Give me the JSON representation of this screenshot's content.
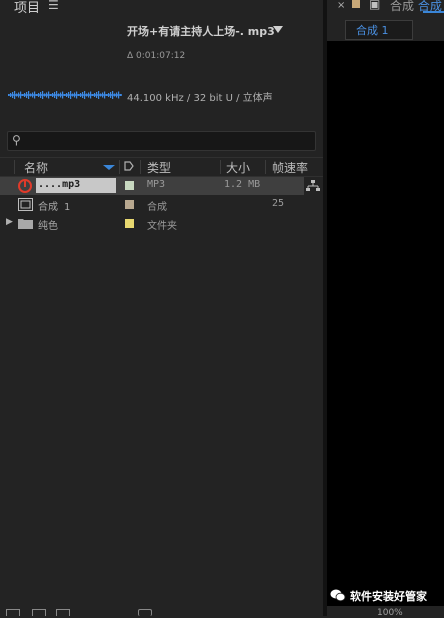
{
  "project_panel": {
    "title": "项目",
    "menu_icon": "hamburger-icon",
    "selected_file": {
      "name": "开场+有请主持人上场-. mp3",
      "duration": "Δ 0:01:07:12",
      "audio_info": "44.100 kHz / 32 bit U / 立体声"
    },
    "search": {
      "placeholder": "",
      "value": ""
    },
    "columns": [
      {
        "label": "名称"
      },
      {
        "label": "类型"
      },
      {
        "label": "大小"
      },
      {
        "label": "帧速率"
      }
    ],
    "rows": [
      {
        "name": "....mp3",
        "type": "MP3",
        "size": "1.2 MB",
        "fps": "",
        "label_color": "#c8d8c0",
        "icon": "audio-file-icon",
        "selected": true
      },
      {
        "name": "合成 1",
        "type": "合成",
        "size": "",
        "fps": "25",
        "label_color": "#b8a890",
        "icon": "composition-icon",
        "selected": false
      },
      {
        "name": "纯色",
        "type": "文件夹",
        "size": "",
        "fps": "",
        "label_color": "#e8d870",
        "icon": "folder-icon",
        "selected": false
      }
    ]
  },
  "comp_panel": {
    "tab_label": "合成",
    "tab_label_2": "合成",
    "subtab_label": "合成 1",
    "zoom": "100%"
  },
  "watermark": {
    "text": "软件安装好管家"
  },
  "colors": {
    "accent": "#3a86d8",
    "background": "#232323",
    "viewer": "#000000"
  }
}
